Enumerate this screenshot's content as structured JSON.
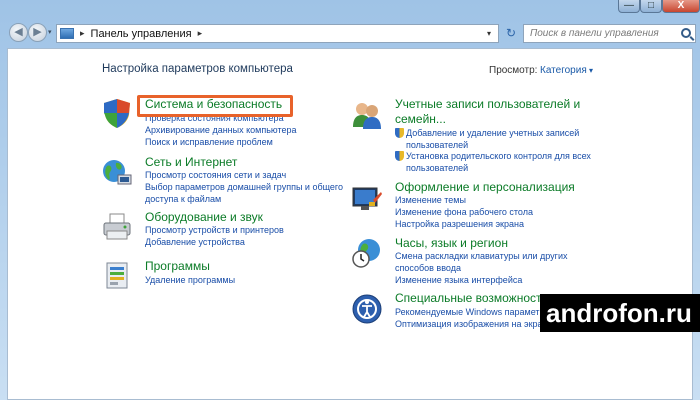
{
  "window": {
    "min_label": "—",
    "max_label": "□",
    "close_label": "X"
  },
  "address_bar": {
    "back_glyph": "◀",
    "forward_glyph": "▶",
    "history_glyph": "▾",
    "separator": "▸",
    "path": "Панель управления",
    "path_chevron": "▸",
    "dropdown_glyph": "▾",
    "refresh_glyph": "↻"
  },
  "search": {
    "placeholder": "Поиск в панели управления"
  },
  "page": {
    "title": "Настройка параметров компьютера",
    "view_label": "Просмотр:",
    "view_value": "Категория"
  },
  "categories_left": [
    {
      "title": "Система и безопасность",
      "icon": "security-shield-icon",
      "links": [
        "Проверка состояния компьютера",
        "Архивирование данных компьютера",
        "Поиск и исправление проблем"
      ]
    },
    {
      "title": "Сеть и Интернет",
      "icon": "network-globe-icon",
      "links": [
        "Просмотр состояния сети и задач",
        "Выбор параметров домашней группы и общего",
        "доступа к файлам"
      ]
    },
    {
      "title": "Оборудование и звук",
      "icon": "printer-icon",
      "links": [
        "Просмотр устройств и принтеров",
        "Добавление устройства"
      ]
    },
    {
      "title": "Программы",
      "icon": "programs-icon",
      "links": [
        "Удаление программы"
      ]
    }
  ],
  "categories_right": [
    {
      "title": "Учетные записи пользователей и",
      "title2": "семейн...",
      "icon": "users-icon",
      "links": [
        "Добавление и удаление учетных записей",
        "пользователей",
        "Установка родительского контроля для всех",
        "пользователей"
      ]
    },
    {
      "title": "Оформление и персонализация",
      "icon": "appearance-icon",
      "links": [
        "Изменение темы",
        "Изменение фона рабочего стола",
        "Настройка разрешения экрана"
      ]
    },
    {
      "title": "Часы, язык и регион",
      "icon": "clock-globe-icon",
      "links": [
        "Смена раскладки клавиатуры или других",
        "способов ввода",
        "Изменение языка интерфейса"
      ]
    },
    {
      "title": "Специальные возможности",
      "icon": "accessibility-icon",
      "links": [
        "Рекомендуемые Windows параметры",
        "Оптимизация изображения на экране"
      ]
    }
  ],
  "watermark": {
    "text": "androfon.ru"
  },
  "colors": {
    "category_title": "#0b7b27",
    "link": "#1a4ea8",
    "highlight": "#e8622a"
  }
}
